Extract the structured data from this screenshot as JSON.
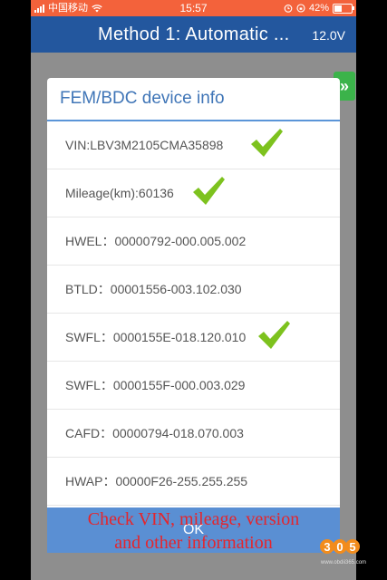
{
  "status_bar": {
    "carrier": "中国移动",
    "time": "15:57",
    "battery": "42%",
    "battery_level": 0.42
  },
  "nav": {
    "title": "Method 1: Automatic ...",
    "voltage": "12.0V"
  },
  "side_tab": {
    "icon": "double-chevron-right-icon"
  },
  "dialog": {
    "title": "FEM/BDC device info",
    "rows": [
      {
        "text": "VIN:LBV3M2105CMA35898",
        "checked": true
      },
      {
        "text": "Mileage(km):60136",
        "checked": true
      },
      {
        "text": "HWEL：00000792-000.005.002",
        "checked": false
      },
      {
        "text": "BTLD：00001556-003.102.030",
        "checked": false
      },
      {
        "text": "SWFL：0000155E-018.120.010",
        "checked": true
      },
      {
        "text": "SWFL：0000155F-000.003.029",
        "checked": false
      },
      {
        "text": "CAFD：00000794-018.070.003",
        "checked": false
      },
      {
        "text": "HWAP：00000F26-255.255.255",
        "checked": false
      }
    ],
    "ok_label": "OK"
  },
  "overlay": {
    "caption_line1": "Check VIN, mileage, version",
    "caption_line2": "and other information",
    "logo_text": "305",
    "site": "www.obdii365.com"
  },
  "colors": {
    "status_bar": "#f3623b",
    "nav_bar": "#23579e",
    "accent": "#3f75b7",
    "check": "#7dc21e",
    "caption": "#e5252c"
  }
}
